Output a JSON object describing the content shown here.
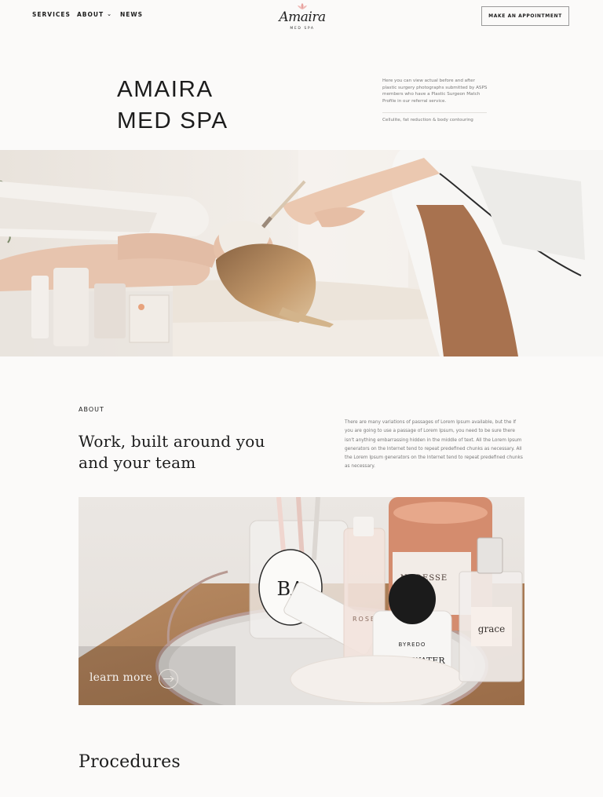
{
  "nav": {
    "services": "SERVICES",
    "about": "ABOUT",
    "about_chevron": "⌄",
    "news": "NEWS"
  },
  "logo": {
    "name": "Amaira",
    "sub": "MED SPA",
    "mark_icon": "lotus-icon"
  },
  "header": {
    "appointment_label": "MAKE AN APPOINTMENT"
  },
  "hero": {
    "title_line1": "AMAIRA",
    "title_line2": "MED SPA",
    "description": "Here you can view actual before and after plastic surgery photographs submitted by ASPS members who have a Plastic Surgeon Match Profile in our referral service.",
    "tag": "Cellulite, fat reduction & body contouring"
  },
  "about": {
    "label": "ABOUT",
    "heading_line1": "Work, built around you",
    "heading_line2": "and your team",
    "text": "There are many variations of passages of Lorem Ipsum available, but the If you are going to use a passage of Lorem Ipsum, you need to be sure there isn't anything embarrassing hidden in the middle of text. All the Lorem Ipsum generators on the Internet tend to repeat predefined chunks as necessary. All the Lorem Ipsum generators on the Internet tend to repeat predefined chunks as necessary."
  },
  "products": {
    "learn_more": "learn more",
    "arrow_icon": "arrow-right-icon",
    "labels": {
      "diptyque": "BA",
      "rose": "ROSE",
      "nudesse": "NUDESSE",
      "byredo": "BYREDO",
      "gypsy": "GYPSY WATER",
      "grace": "grace"
    }
  },
  "procedures": {
    "heading": "Procedures"
  },
  "colors": {
    "background": "#fbfaf9",
    "text": "#1c1c1c",
    "muted": "#777777",
    "logo_pink": "#e8a3a0"
  }
}
